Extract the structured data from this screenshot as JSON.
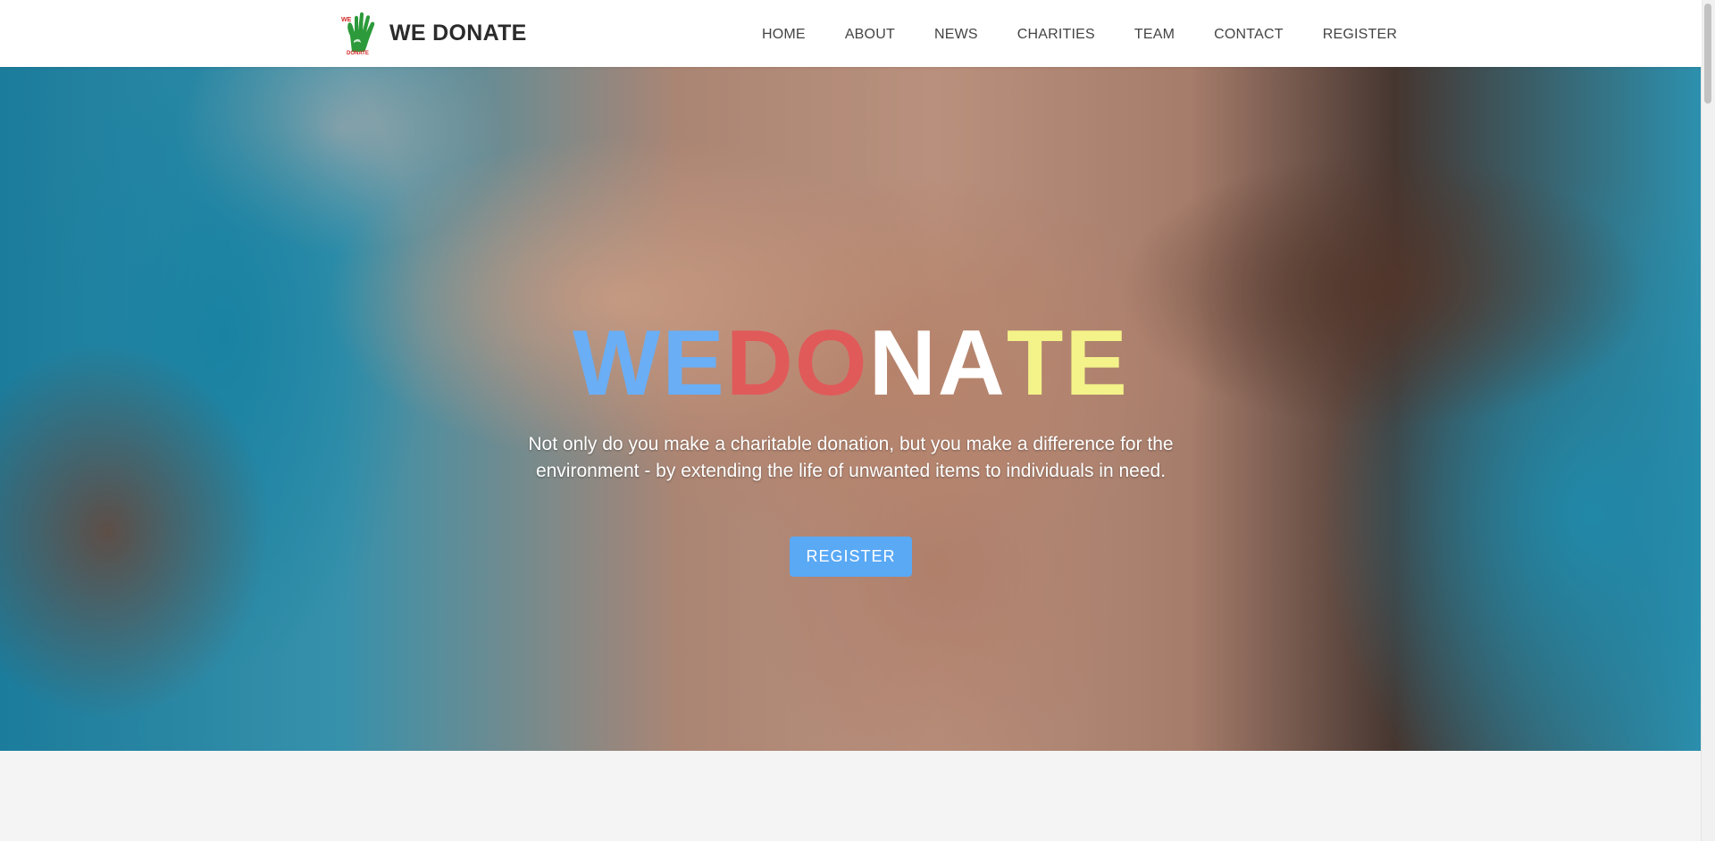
{
  "header": {
    "brand_name": "WE DONATE",
    "logo_icon": "green-hand-icon"
  },
  "nav": {
    "items": [
      {
        "label": "HOME"
      },
      {
        "label": "ABOUT"
      },
      {
        "label": "NEWS"
      },
      {
        "label": "CHARITIES"
      },
      {
        "label": "TEAM"
      },
      {
        "label": "CONTACT"
      },
      {
        "label": "REGISTER"
      }
    ]
  },
  "hero": {
    "title_parts": [
      {
        "text": "WE ",
        "color": "#6aaef5"
      },
      {
        "text": "DO",
        "color": "#e05a5a"
      },
      {
        "text": "NA",
        "color": "#ffffff"
      },
      {
        "text": "TE",
        "color": "#f4f38a"
      }
    ],
    "subtitle": "Not only do you make a charitable donation, but you make a difference for the environment - by extending the life of unwanted items to individuals in need.",
    "cta_label": "REGISTER",
    "cta_color": "#5aa9f5"
  },
  "colors": {
    "navbar_bg": "#ffffff",
    "page_bg": "#f4f4f4",
    "logo_green": "#2c9a3a",
    "logo_red": "#d22a2a"
  }
}
